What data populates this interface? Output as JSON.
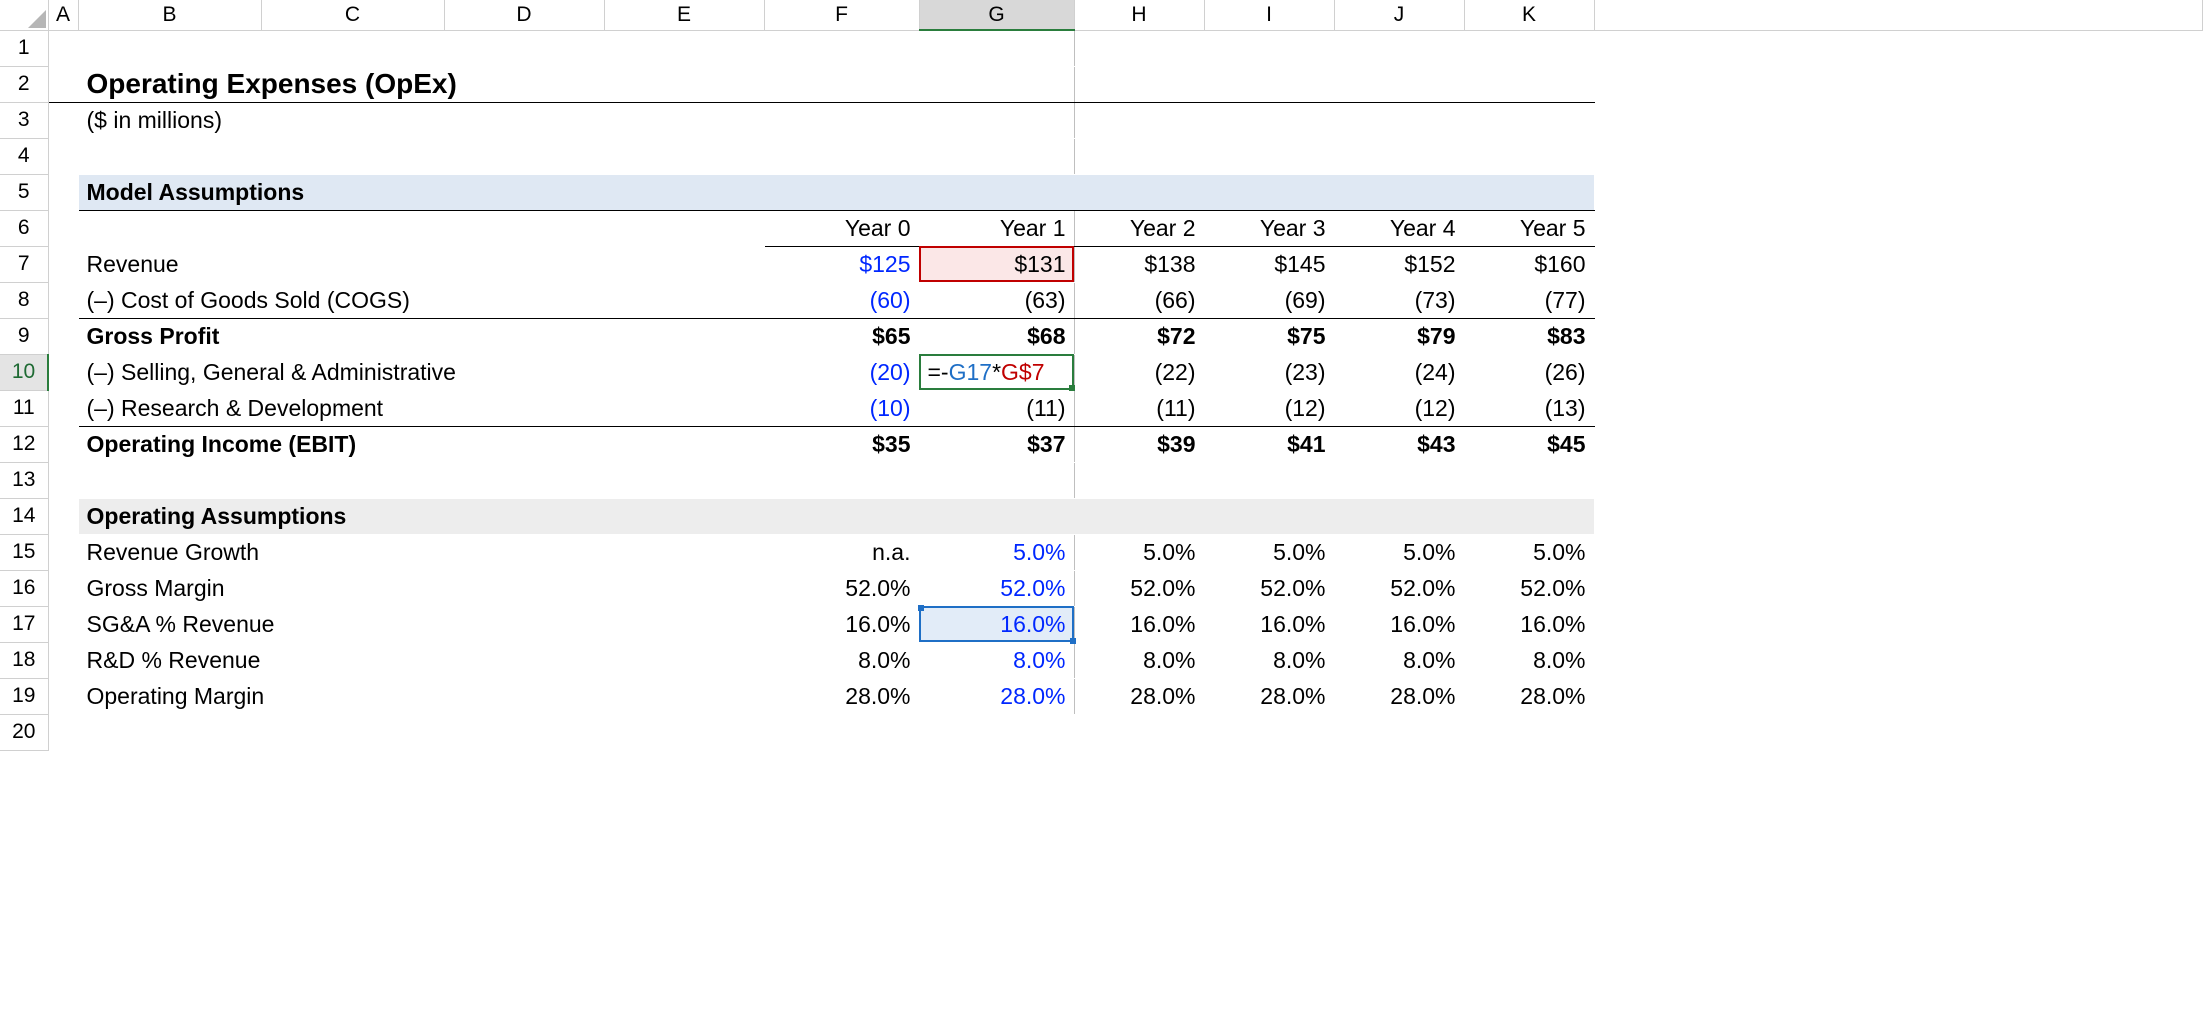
{
  "columns": [
    "A",
    "B",
    "C",
    "D",
    "E",
    "F",
    "G",
    "H",
    "I",
    "J",
    "K",
    ""
  ],
  "selected_col": "G",
  "rows": [
    "1",
    "2",
    "3",
    "4",
    "5",
    "6",
    "7",
    "8",
    "9",
    "10",
    "11",
    "12",
    "13",
    "14",
    "15",
    "16",
    "17",
    "18",
    "19",
    "20"
  ],
  "selected_row": "10",
  "title": "Operating Expenses (OpEx)",
  "subtitle": "($ in millions)",
  "section_assumptions": "Model Assumptions",
  "years": {
    "F": "Year 0",
    "G": "Year 1",
    "H": "Year 2",
    "I": "Year 3",
    "J": "Year 4",
    "K": "Year 5"
  },
  "rows_data": {
    "revenue": {
      "label": "Revenue",
      "F": "$125",
      "G": "$131",
      "H": "$138",
      "I": "$145",
      "J": "$152",
      "K": "$160"
    },
    "cogs": {
      "label": "(–) Cost of Goods Sold (COGS)",
      "F": "(60)",
      "G": "(63)",
      "H": "(66)",
      "I": "(69)",
      "J": "(73)",
      "K": "(77)"
    },
    "gross_profit": {
      "label": "Gross Profit",
      "F": "$65",
      "G": "$68",
      "H": "$72",
      "I": "$75",
      "J": "$79",
      "K": "$83"
    },
    "sga": {
      "label": "(–) Selling, General & Administrative",
      "F": "(20)",
      "G_formula": {
        "prefix": "=-",
        "a": "G17",
        "mid": "*",
        "b": "G$7"
      },
      "H": "(22)",
      "I": "(23)",
      "J": "(24)",
      "K": "(26)"
    },
    "rnd": {
      "label": "(–) Research & Development",
      "F": "(10)",
      "G": "(11)",
      "H": "(11)",
      "I": "(12)",
      "J": "(12)",
      "K": "(13)"
    },
    "ebit": {
      "label": "Operating Income (EBIT)",
      "F": "$35",
      "G": "$37",
      "H": "$39",
      "I": "$41",
      "J": "$43",
      "K": "$45"
    }
  },
  "section_operating": "Operating Assumptions",
  "assumptions": {
    "rev_growth": {
      "label": "Revenue Growth",
      "F": "n.a.",
      "G": "5.0%",
      "H": "5.0%",
      "I": "5.0%",
      "J": "5.0%",
      "K": "5.0%"
    },
    "gross_margin": {
      "label": "Gross Margin",
      "F": "52.0%",
      "G": "52.0%",
      "H": "52.0%",
      "I": "52.0%",
      "J": "52.0%",
      "K": "52.0%"
    },
    "sga_pct": {
      "label": "SG&A % Revenue",
      "F": "16.0%",
      "G": "16.0%",
      "H": "16.0%",
      "I": "16.0%",
      "J": "16.0%",
      "K": "16.0%"
    },
    "rnd_pct": {
      "label": "R&D % Revenue",
      "F": "8.0%",
      "G": "8.0%",
      "H": "8.0%",
      "I": "8.0%",
      "J": "8.0%",
      "K": "8.0%"
    },
    "op_margin": {
      "label": "Operating Margin",
      "F": "28.0%",
      "G": "28.0%",
      "H": "28.0%",
      "I": "28.0%",
      "J": "28.0%",
      "K": "28.0%"
    }
  }
}
